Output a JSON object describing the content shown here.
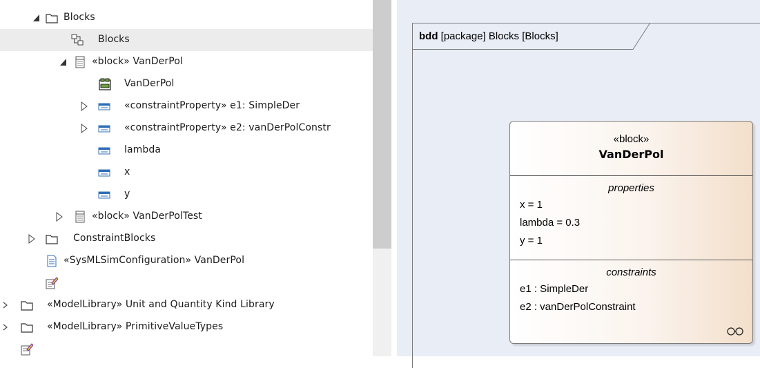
{
  "browser": {
    "items": [
      {
        "label": "Blocks",
        "icon": "folder-icon",
        "expanded": true
      },
      {
        "label": "Blocks",
        "icon": "diagram-icon",
        "selected": true
      },
      {
        "label": "«block» VanDerPol",
        "icon": "block-icon",
        "expanded": true
      },
      {
        "label": "VanDerPol",
        "icon": "internal-diagram-icon"
      },
      {
        "label": "«constraintProperty» e1: SimpleDer",
        "icon": "property-icon",
        "expanded": false
      },
      {
        "label": "«constraintProperty» e2: vanDerPolConstr",
        "icon": "property-icon",
        "expanded": false
      },
      {
        "label": "lambda",
        "icon": "property-icon"
      },
      {
        "label": "x",
        "icon": "property-icon"
      },
      {
        "label": "y",
        "icon": "property-icon"
      },
      {
        "label": "«block» VanDerPolTest",
        "icon": "block-icon",
        "expanded": false
      },
      {
        "label": "ConstraintBlocks",
        "icon": "folder-icon",
        "expanded": false
      },
      {
        "label": "«SysMLSimConfiguration» VanDerPol",
        "icon": "artifact-icon"
      },
      {
        "label": "",
        "icon": "notes-icon"
      },
      {
        "label": "«ModelLibrary» Unit and Quantity Kind Library",
        "icon": "folder-icon",
        "expanded": false
      },
      {
        "label": "«ModelLibrary» PrimitiveValueTypes",
        "icon": "folder-icon",
        "expanded": false
      },
      {
        "label": "",
        "icon": "notes-icon"
      }
    ]
  },
  "diagram": {
    "frame_kind": "bdd",
    "frame_rest": " [package] Blocks [Blocks]",
    "block": {
      "stereotype": "«block»",
      "name": "VanDerPol",
      "properties_title": "properties",
      "properties": [
        "x = 1",
        "lambda = 0.3",
        "y = 1"
      ],
      "constraints_title": "constraints",
      "constraints": [
        "e1 : SimpleDer",
        "e2 : vanDerPolConstraint"
      ]
    }
  },
  "colors": {
    "canvas": "#e9edf6",
    "block_gradient_end": "#f3dfcb",
    "folder": "#d9a94a",
    "icon_blue": "#2f6fb5"
  }
}
